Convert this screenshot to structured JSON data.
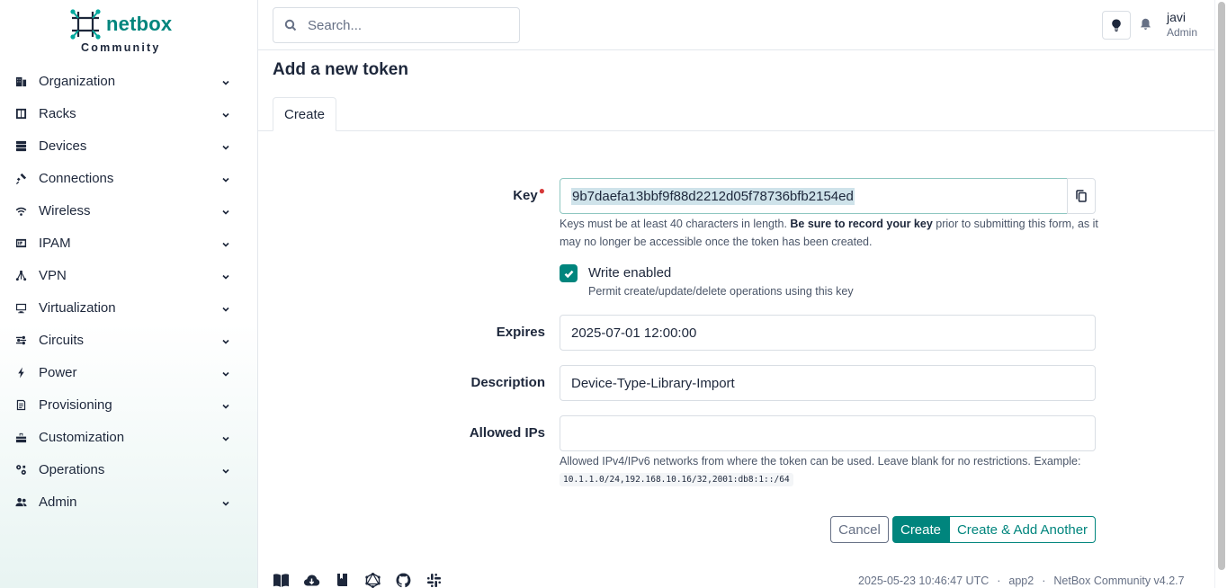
{
  "brand": {
    "name": "netbox",
    "subtitle": "Community"
  },
  "sidebar": {
    "items": [
      {
        "label": "Organization",
        "icon": "organization-icon"
      },
      {
        "label": "Racks",
        "icon": "racks-icon"
      },
      {
        "label": "Devices",
        "icon": "devices-icon"
      },
      {
        "label": "Connections",
        "icon": "connections-icon"
      },
      {
        "label": "Wireless",
        "icon": "wireless-icon"
      },
      {
        "label": "IPAM",
        "icon": "ipam-icon"
      },
      {
        "label": "VPN",
        "icon": "vpn-icon"
      },
      {
        "label": "Virtualization",
        "icon": "virtualization-icon"
      },
      {
        "label": "Circuits",
        "icon": "circuits-icon"
      },
      {
        "label": "Power",
        "icon": "power-icon"
      },
      {
        "label": "Provisioning",
        "icon": "provisioning-icon"
      },
      {
        "label": "Customization",
        "icon": "customization-icon"
      },
      {
        "label": "Operations",
        "icon": "operations-icon"
      },
      {
        "label": "Admin",
        "icon": "admin-icon"
      }
    ]
  },
  "header": {
    "search_placeholder": "Search...",
    "user": {
      "name": "javi",
      "role": "Admin"
    }
  },
  "main": {
    "title": "Add a new token",
    "tabs": [
      {
        "label": "Create",
        "active": true
      }
    ],
    "form": {
      "key": {
        "label": "Key",
        "required": true,
        "value": "9b7daefa13bbf9f88d2212d05f78736bfb2154ed",
        "help_pre": "Keys must be at least 40 characters in length. ",
        "help_bold": "Be sure to record your key",
        "help_post": " prior to submitting this form, as it may no longer be accessible once the token has been created."
      },
      "write_enabled": {
        "label": "Write enabled",
        "checked": true,
        "help": "Permit create/update/delete operations using this key"
      },
      "expires": {
        "label": "Expires",
        "value": "2025-07-01 12:00:00"
      },
      "description": {
        "label": "Description",
        "value": "Device-Type-Library-Import"
      },
      "allowed_ips": {
        "label": "Allowed IPs",
        "value": "",
        "help": "Allowed IPv4/IPv6 networks from where the token can be used. Leave blank for no restrictions. Example:",
        "example": "10.1.1.0/24,192.168.10.16/32,2001:db8:1::/64"
      }
    },
    "buttons": {
      "cancel": "Cancel",
      "create": "Create",
      "create_another": "Create & Add Another"
    }
  },
  "footer": {
    "timestamp": "2025-05-23 10:46:47 UTC",
    "node": "app2",
    "version": "NetBox Community v4.2.7",
    "separator": "·"
  },
  "colors": {
    "brand": "#00857d",
    "text": "#1d273b",
    "muted": "#667085",
    "required": "#d63939"
  }
}
